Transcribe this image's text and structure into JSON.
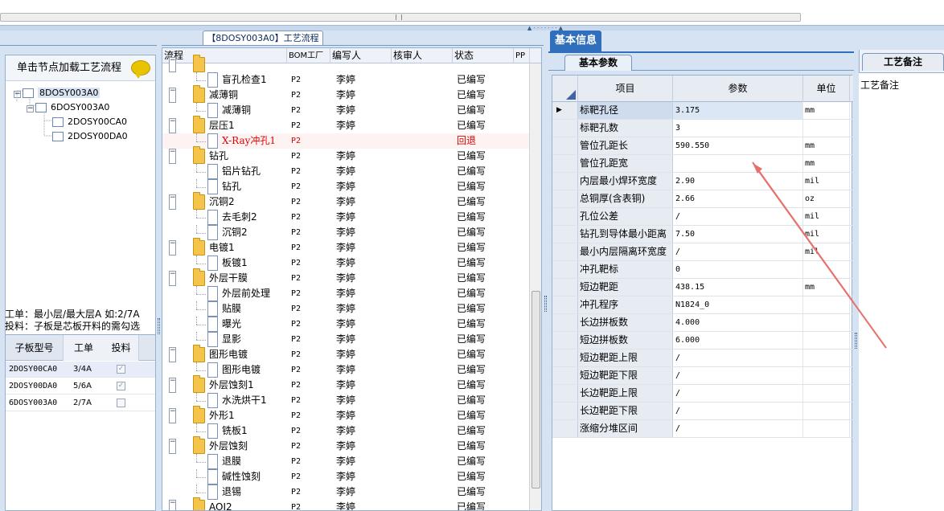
{
  "tree_root_tab": "【8DOSY003A0】工艺流程",
  "left": {
    "load_label": "单击节点加载工艺流程",
    "tree": [
      "8DOSY003A0",
      "6DOSY003A0",
      "2DOSY00CA0",
      "2DOSY00DA0"
    ],
    "info_line1": "工单：最小层/最大层A 如:2/7A",
    "info_line2": "投料：子板是芯板开料的需勾选",
    "grid_headers": [
      "子板型号",
      "工单",
      "投料"
    ],
    "grid_rows": [
      {
        "model": "2DOSY00CA0",
        "order": "3/4A",
        "feed": true
      },
      {
        "model": "2DOSY00DA0",
        "order": "5/6A",
        "feed": true
      },
      {
        "model": "6DOSY003A0",
        "order": "2/7A",
        "feed": false
      }
    ]
  },
  "flow": {
    "headers": [
      "流程",
      "BOM工厂",
      "编写人",
      "核审人",
      "状态",
      "PP"
    ],
    "rows": [
      {
        "name": "",
        "type": "folder",
        "bom": "",
        "writer": "",
        "status": ""
      },
      {
        "name": "盲孔检查1",
        "type": "doc",
        "bom": "P2",
        "writer": "李婷",
        "status": "已编写"
      },
      {
        "name": "减薄铜",
        "type": "folder",
        "bom": "P2",
        "writer": "李婷",
        "status": "已编写"
      },
      {
        "name": "减薄铜",
        "type": "doc",
        "bom": "P2",
        "writer": "李婷",
        "status": "已编写"
      },
      {
        "name": "层压1",
        "type": "folder",
        "bom": "P2",
        "writer": "李婷",
        "status": "已编写"
      },
      {
        "name": "X-Ray冲孔1",
        "type": "doc",
        "bom": "P2",
        "writer": "",
        "status": "回退",
        "red": true
      },
      {
        "name": "钻孔",
        "type": "folder",
        "bom": "P2",
        "writer": "李婷",
        "status": "已编写"
      },
      {
        "name": "铝片钻孔",
        "type": "doc",
        "bom": "P2",
        "writer": "李婷",
        "status": "已编写"
      },
      {
        "name": "钻孔",
        "type": "doc",
        "bom": "P2",
        "writer": "李婷",
        "status": "已编写"
      },
      {
        "name": "沉铜2",
        "type": "folder",
        "bom": "P2",
        "writer": "李婷",
        "status": "已编写"
      },
      {
        "name": "去毛刺2",
        "type": "doc",
        "bom": "P2",
        "writer": "李婷",
        "status": "已编写"
      },
      {
        "name": "沉铜2",
        "type": "doc",
        "bom": "P2",
        "writer": "李婷",
        "status": "已编写"
      },
      {
        "name": "电镀1",
        "type": "folder",
        "bom": "P2",
        "writer": "李婷",
        "status": "已编写"
      },
      {
        "name": "板镀1",
        "type": "doc",
        "bom": "P2",
        "writer": "李婷",
        "status": "已编写"
      },
      {
        "name": "外层干膜",
        "type": "folder",
        "bom": "P2",
        "writer": "李婷",
        "status": "已编写"
      },
      {
        "name": "外层前处理",
        "type": "doc",
        "bom": "P2",
        "writer": "李婷",
        "status": "已编写"
      },
      {
        "name": "贴膜",
        "type": "doc",
        "bom": "P2",
        "writer": "李婷",
        "status": "已编写"
      },
      {
        "name": "曝光",
        "type": "doc",
        "bom": "P2",
        "writer": "李婷",
        "status": "已编写"
      },
      {
        "name": "显影",
        "type": "doc",
        "bom": "P2",
        "writer": "李婷",
        "status": "已编写"
      },
      {
        "name": "图形电镀",
        "type": "folder",
        "bom": "P2",
        "writer": "李婷",
        "status": "已编写"
      },
      {
        "name": "图形电镀",
        "type": "doc",
        "bom": "P2",
        "writer": "李婷",
        "status": "已编写"
      },
      {
        "name": "外层蚀刻1",
        "type": "folder",
        "bom": "P2",
        "writer": "李婷",
        "status": "已编写"
      },
      {
        "name": "水洗烘干1",
        "type": "doc",
        "bom": "P2",
        "writer": "李婷",
        "status": "已编写"
      },
      {
        "name": "外形1",
        "type": "folder",
        "bom": "P2",
        "writer": "李婷",
        "status": "已编写"
      },
      {
        "name": "铣板1",
        "type": "doc",
        "bom": "P2",
        "writer": "李婷",
        "status": "已编写"
      },
      {
        "name": "外层蚀刻",
        "type": "folder",
        "bom": "P2",
        "writer": "李婷",
        "status": "已编写"
      },
      {
        "name": "退膜",
        "type": "doc",
        "bom": "P2",
        "writer": "李婷",
        "status": "已编写"
      },
      {
        "name": "碱性蚀刻",
        "type": "doc",
        "bom": "P2",
        "writer": "李婷",
        "status": "已编写"
      },
      {
        "name": "退锡",
        "type": "doc",
        "bom": "P2",
        "writer": "李婷",
        "status": "已编写"
      },
      {
        "name": "AOI2",
        "type": "folder",
        "bom": "P2",
        "writer": "李婷",
        "status": "已编写"
      }
    ]
  },
  "basic": {
    "tab": "基本信息",
    "subtab": "基本参数",
    "headers": [
      "项目",
      "参数",
      "单位"
    ],
    "rows": [
      {
        "item": "标靶孔径",
        "value": "3.175",
        "unit": "mm"
      },
      {
        "item": "标靶孔数",
        "value": "3",
        "unit": ""
      },
      {
        "item": "管位孔距长",
        "value": "590.550",
        "unit": "mm"
      },
      {
        "item": "管位孔距宽",
        "value": "",
        "unit": "mm"
      },
      {
        "item": "内层最小焊环宽度",
        "value": "2.90",
        "unit": "mil"
      },
      {
        "item": "总铜厚(含表铜)",
        "value": "2.66",
        "unit": "oz"
      },
      {
        "item": "孔位公差",
        "value": "/",
        "unit": "mil"
      },
      {
        "item": "钻孔到导体最小距离",
        "value": "7.50",
        "unit": "mil"
      },
      {
        "item": "最小内层隔离环宽度",
        "value": "/",
        "unit": "mil"
      },
      {
        "item": "冲孔靶标",
        "value": "0",
        "unit": ""
      },
      {
        "item": "短边靶距",
        "value": "438.15",
        "unit": "mm"
      },
      {
        "item": "冲孔程序",
        "value": "N1824_0",
        "unit": ""
      },
      {
        "item": "长边拼板数",
        "value": "4.000",
        "unit": ""
      },
      {
        "item": "短边拼板数",
        "value": "6.000",
        "unit": ""
      },
      {
        "item": "短边靶距上限",
        "value": "/",
        "unit": ""
      },
      {
        "item": "短边靶距下限",
        "value": "/",
        "unit": ""
      },
      {
        "item": "长边靶距上限",
        "value": "/",
        "unit": ""
      },
      {
        "item": "长边靶距下限",
        "value": "/",
        "unit": ""
      },
      {
        "item": "涨缩分堆区间",
        "value": "/",
        "unit": ""
      }
    ]
  },
  "remarks": {
    "tab": "工艺备注",
    "label": "工艺备注"
  },
  "colors": {
    "accent": "#2f6fbb",
    "returned": "#e00000",
    "arrow": "#e8706b"
  }
}
